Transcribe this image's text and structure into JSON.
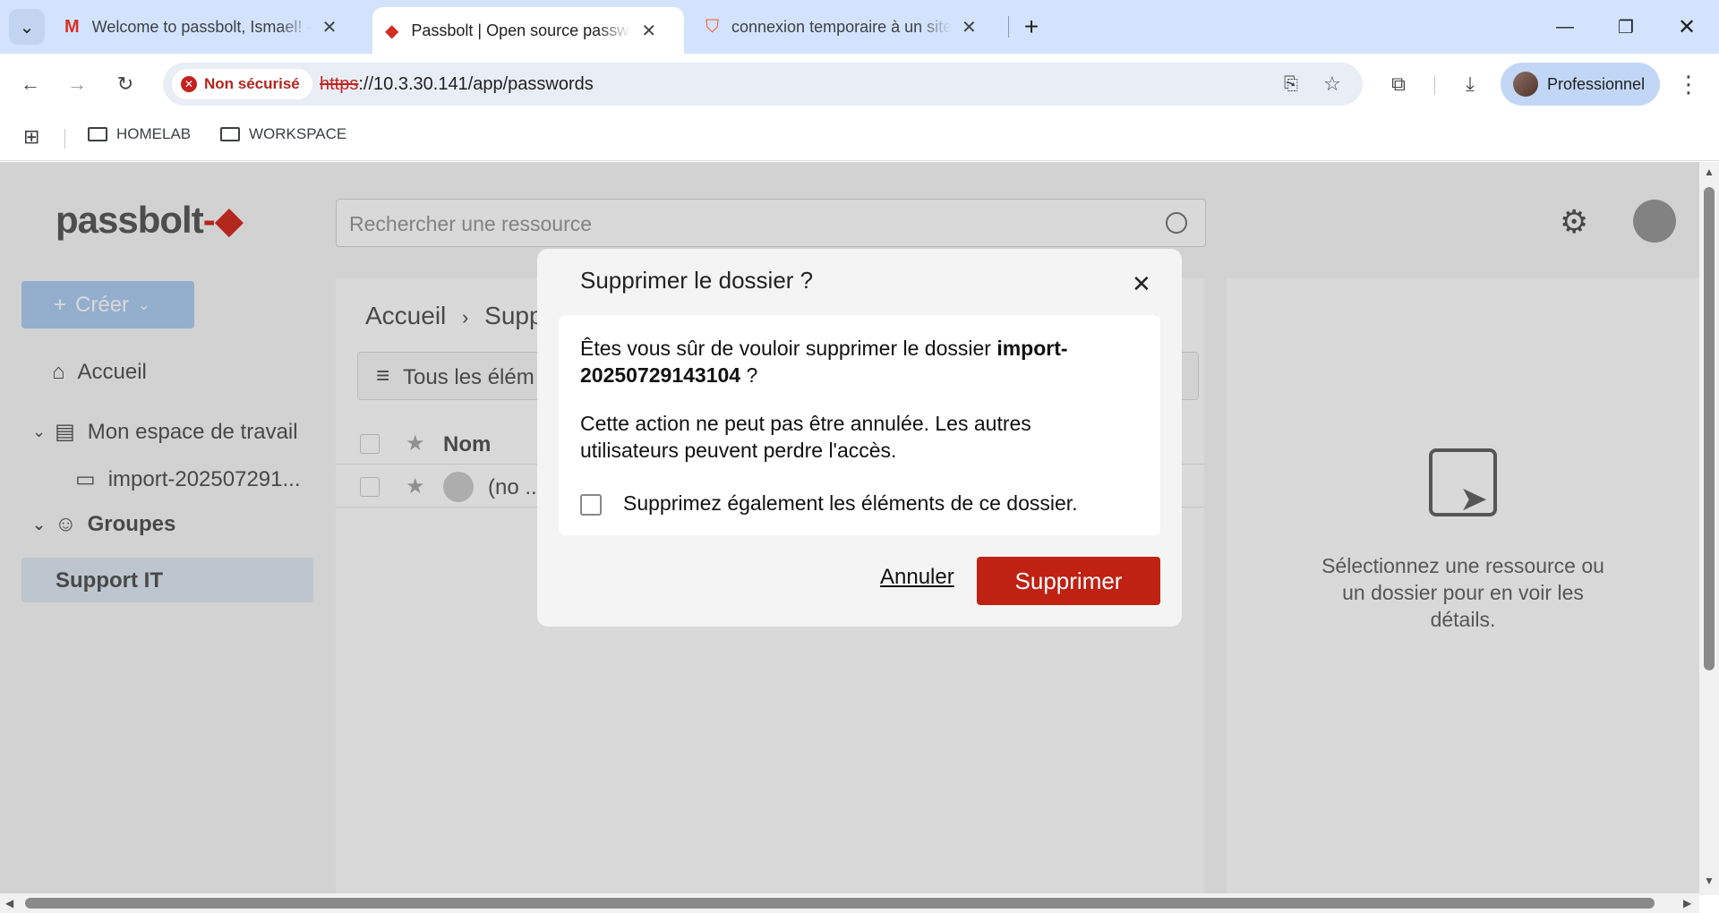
{
  "browser": {
    "tabs": [
      {
        "title": "Welcome to passbolt, Ismael! -",
        "favicon": "gmail-icon"
      },
      {
        "title": "Passbolt | Open source passwor",
        "favicon": "passbolt-icon"
      },
      {
        "title": "connexion temporaire à un site",
        "favicon": "brave-icon"
      }
    ],
    "security_label": "Non sécurisé",
    "url_scheme": "https",
    "url_rest": "://10.3.30.141/app/passwords",
    "profile_label": "Professionnel",
    "bookmarks": [
      "HOMELAB",
      "WORKSPACE"
    ]
  },
  "app": {
    "logo_text": "passbolt",
    "search_placeholder": "Rechercher une ressource",
    "create_label": "Créer",
    "sidebar": {
      "home": "Accueil",
      "workspace": "Mon espace de travail",
      "folder": "import-202507291...",
      "groups": "Groupes",
      "selected_group": "Support IT"
    },
    "breadcrumb": {
      "home": "Accueil",
      "current": "Supp"
    },
    "filter_label": "Tous les élém",
    "table": {
      "col_name": "Nom",
      "row_name": "(no ..."
    },
    "details_empty": "Sélectionnez une ressource ou un dossier pour en voir les détails."
  },
  "dialog": {
    "title": "Supprimer le dossier ?",
    "question_prefix": "Êtes vous sûr de vouloir supprimer le dossier ",
    "folder_name": "import-20250729143104",
    "question_suffix": " ?",
    "warning": "Cette action ne peut pas être annulée. Les autres utilisateurs peuvent perdre l'accès.",
    "checkbox_label": "Supprimez également les éléments de ce dossier.",
    "checkbox_checked": false,
    "cancel_label": "Annuler",
    "confirm_label": "Supprimer",
    "confirm_color": "#bf2113"
  }
}
